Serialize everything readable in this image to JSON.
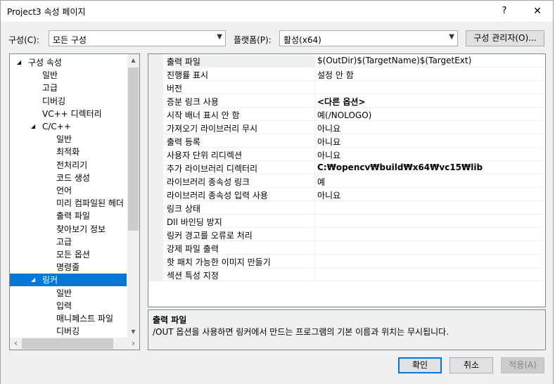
{
  "window": {
    "title": "Project3 속성 페이지",
    "help_glyph": "?",
    "close_glyph": "✕"
  },
  "config": {
    "config_label": "구성(C):",
    "config_value": "모든 구성",
    "platform_label": "플랫폼(P):",
    "platform_value": "활성(x64)",
    "manager_button": "구성 관리자(O)..."
  },
  "tree": {
    "items": [
      {
        "label": "구성 속성",
        "toggle": "◢"
      },
      {
        "label": "일반"
      },
      {
        "label": "고급"
      },
      {
        "label": "디버깅"
      },
      {
        "label": "VC++ 디렉터리"
      },
      {
        "label": "C/C++",
        "toggle": "◢"
      },
      {
        "label": "일반"
      },
      {
        "label": "최적화"
      },
      {
        "label": "전처리기"
      },
      {
        "label": "코드 생성"
      },
      {
        "label": "언어"
      },
      {
        "label": "미리 컴파일된 헤더"
      },
      {
        "label": "출력 파일"
      },
      {
        "label": "찾아보기 정보"
      },
      {
        "label": "고급"
      },
      {
        "label": "모든 옵션"
      },
      {
        "label": "명령줄"
      },
      {
        "label": "링커",
        "toggle": "◢",
        "selected": true
      },
      {
        "label": "일반"
      },
      {
        "label": "입력"
      },
      {
        "label": "매니페스트 파일"
      },
      {
        "label": "디버깅"
      }
    ]
  },
  "properties": {
    "rows": [
      {
        "name": "출력 파일",
        "value": "$(OutDir)$(TargetName)$(TargetExt)"
      },
      {
        "name": "진행률 표시",
        "value": "설정 안 함"
      },
      {
        "name": "버전",
        "value": ""
      },
      {
        "name": "증분 링크 사용",
        "value": "<다른 옵션>"
      },
      {
        "name": "시작 배너 표시 안 함",
        "value": "예(/NOLOGO)"
      },
      {
        "name": "가져오기 라이브러리 무시",
        "value": "아니요"
      },
      {
        "name": "출력 등록",
        "value": "아니요"
      },
      {
        "name": "사용자 단위 리디렉션",
        "value": "아니요"
      },
      {
        "name": "추가 라이브러리 디렉터리",
        "value": "C:₩opencv₩build₩x64₩vc15₩lib"
      },
      {
        "name": "라이브러리 종속성 링크",
        "value": "예"
      },
      {
        "name": "라이브러리 종속성 입력 사용",
        "value": "아니요"
      },
      {
        "name": "링크 상태",
        "value": ""
      },
      {
        "name": "Dll 바인딩 방지",
        "value": ""
      },
      {
        "name": "링커 경고를 오류로 처리",
        "value": ""
      },
      {
        "name": "강제 파일 출력",
        "value": ""
      },
      {
        "name": "핫 패치 가능한 이미지 만들기",
        "value": ""
      },
      {
        "name": "섹션 특성 지정",
        "value": ""
      }
    ]
  },
  "description": {
    "title": "출력 파일",
    "text": "/OUT 옵션을 사용하면 링커에서 만드는 프로그램의 기본 이름과 위치는 무시됩니다."
  },
  "buttons": {
    "ok": "확인",
    "cancel": "취소",
    "apply": "적용(A)"
  }
}
